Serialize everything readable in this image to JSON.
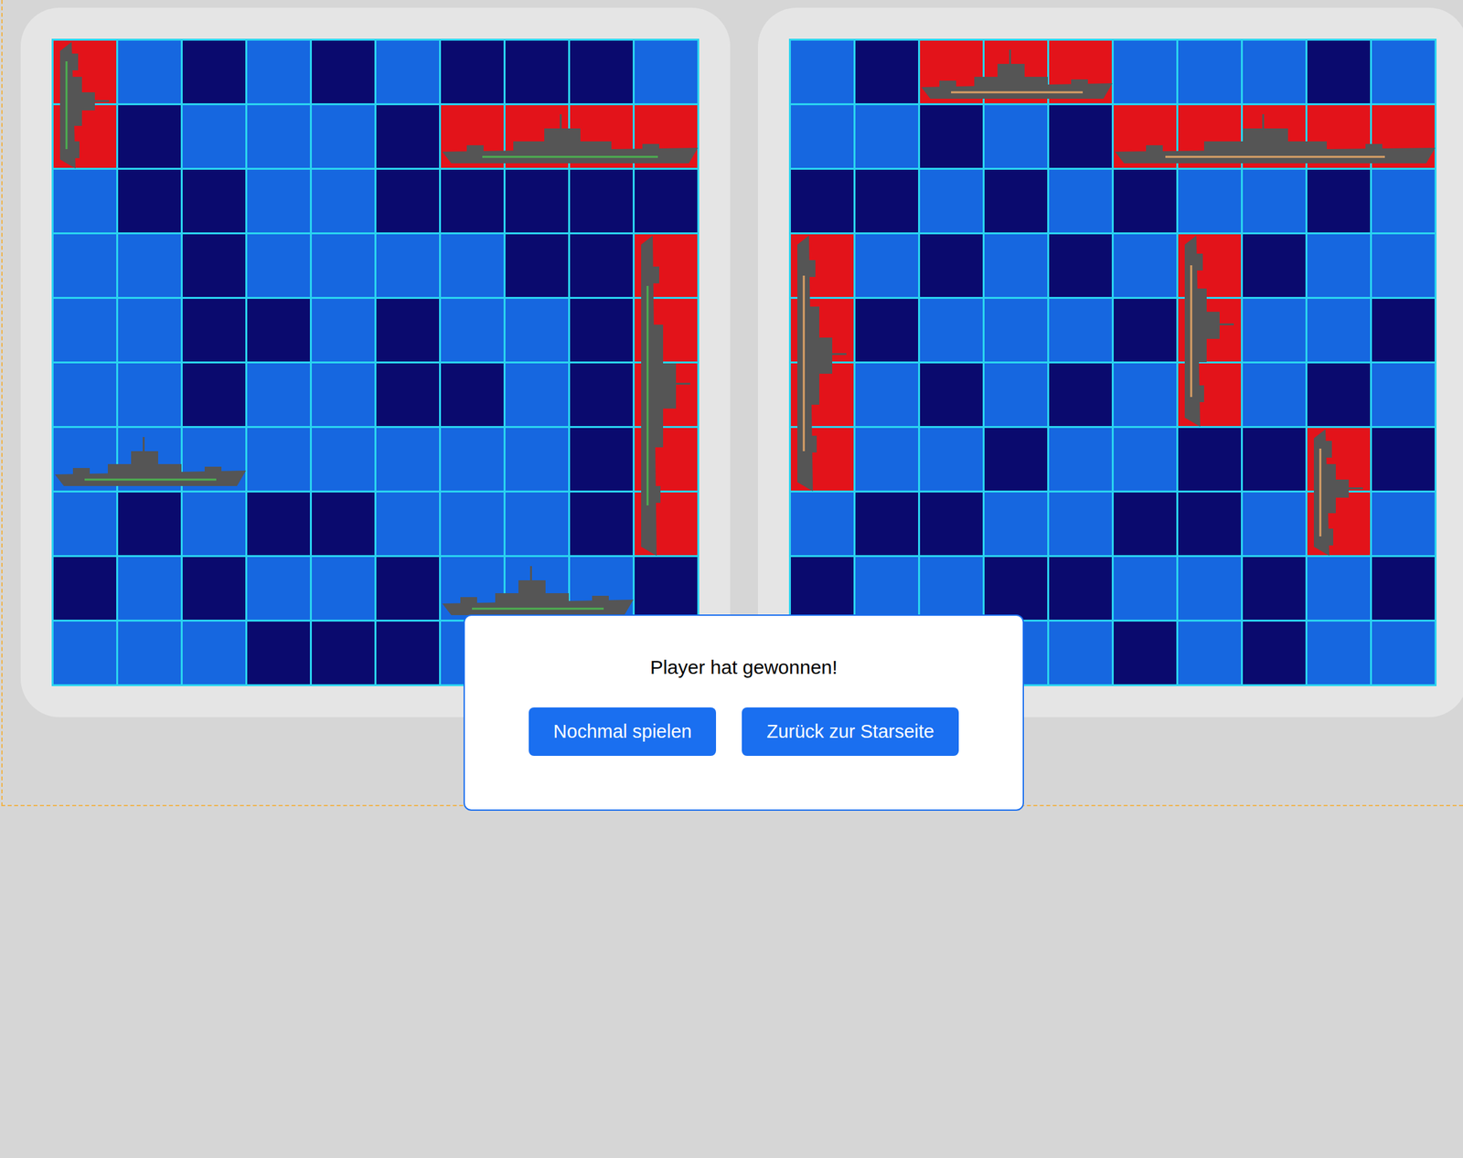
{
  "boards": [
    {
      "cells": [
        [
          "hit",
          "water",
          "miss",
          "water",
          "miss",
          "water",
          "miss",
          "miss",
          "miss",
          "water"
        ],
        [
          "hit",
          "miss",
          "water",
          "water",
          "water",
          "miss",
          "hit",
          "hit",
          "hit",
          "hit"
        ],
        [
          "water",
          "miss",
          "miss",
          "water",
          "water",
          "miss",
          "miss",
          "miss",
          "miss",
          "miss"
        ],
        [
          "water",
          "water",
          "miss",
          "water",
          "water",
          "water",
          "water",
          "miss",
          "miss",
          "hit"
        ],
        [
          "water",
          "water",
          "miss",
          "miss",
          "water",
          "miss",
          "water",
          "water",
          "miss",
          "hit"
        ],
        [
          "water",
          "water",
          "miss",
          "water",
          "water",
          "miss",
          "miss",
          "water",
          "miss",
          "hit"
        ],
        [
          "water",
          "water",
          "water",
          "water",
          "water",
          "water",
          "water",
          "water",
          "miss",
          "hit"
        ],
        [
          "water",
          "miss",
          "water",
          "miss",
          "miss",
          "water",
          "water",
          "water",
          "miss",
          "hit"
        ],
        [
          "miss",
          "water",
          "miss",
          "water",
          "water",
          "miss",
          "water",
          "water",
          "water",
          "miss"
        ],
        [
          "water",
          "water",
          "water",
          "miss",
          "miss",
          "miss",
          "water",
          "water",
          "water",
          "water"
        ]
      ],
      "ships": [
        {
          "row": 0,
          "col": 0,
          "length": 2,
          "orientation": "vertical",
          "color": "#4caf50"
        },
        {
          "row": 1,
          "col": 6,
          "length": 4,
          "orientation": "horizontal",
          "color": "#4caf50"
        },
        {
          "row": 3,
          "col": 9,
          "length": 5,
          "orientation": "vertical",
          "color": "#4caf50"
        },
        {
          "row": 6,
          "col": 0,
          "length": 3,
          "orientation": "horizontal",
          "color": "#4caf50"
        },
        {
          "row": 8,
          "col": 6,
          "length": 3,
          "orientation": "horizontal",
          "color": "#4caf50"
        }
      ]
    },
    {
      "cells": [
        [
          "water",
          "miss",
          "hit",
          "hit",
          "hit",
          "water",
          "water",
          "water",
          "miss",
          "water"
        ],
        [
          "water",
          "water",
          "miss",
          "water",
          "miss",
          "hit",
          "hit",
          "hit",
          "hit",
          "hit"
        ],
        [
          "miss",
          "miss",
          "water",
          "miss",
          "water",
          "miss",
          "water",
          "water",
          "miss",
          "water"
        ],
        [
          "hit",
          "water",
          "miss",
          "water",
          "miss",
          "water",
          "hit",
          "miss",
          "water",
          "water"
        ],
        [
          "hit",
          "miss",
          "water",
          "water",
          "water",
          "miss",
          "hit",
          "water",
          "water",
          "miss"
        ],
        [
          "hit",
          "water",
          "miss",
          "water",
          "miss",
          "water",
          "hit",
          "water",
          "miss",
          "water"
        ],
        [
          "hit",
          "water",
          "water",
          "miss",
          "water",
          "water",
          "miss",
          "miss",
          "hit",
          "miss"
        ],
        [
          "water",
          "miss",
          "miss",
          "water",
          "water",
          "miss",
          "miss",
          "water",
          "hit",
          "water"
        ],
        [
          "miss",
          "water",
          "water",
          "miss",
          "miss",
          "water",
          "water",
          "miss",
          "water",
          "miss"
        ],
        [
          "water",
          "water",
          "water",
          "water",
          "water",
          "miss",
          "water",
          "miss",
          "water",
          "water"
        ]
      ],
      "ships": [
        {
          "row": 0,
          "col": 2,
          "length": 3,
          "orientation": "horizontal",
          "color": "#d9a066"
        },
        {
          "row": 1,
          "col": 5,
          "length": 5,
          "orientation": "horizontal",
          "color": "#d9a066"
        },
        {
          "row": 3,
          "col": 0,
          "length": 4,
          "orientation": "vertical",
          "color": "#d9a066"
        },
        {
          "row": 3,
          "col": 6,
          "length": 3,
          "orientation": "vertical",
          "color": "#d9a066"
        },
        {
          "row": 6,
          "col": 8,
          "length": 2,
          "orientation": "vertical",
          "color": "#d9a066"
        }
      ]
    }
  ],
  "dialog": {
    "message": "Player hat gewonnen!",
    "buttons": [
      "Nochmal spielen",
      "Zurück zur Starseite"
    ]
  }
}
